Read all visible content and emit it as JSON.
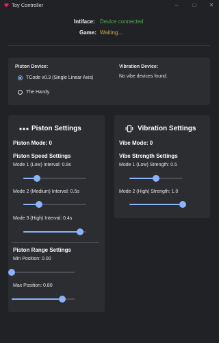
{
  "window": {
    "title": "Toy Controller",
    "minimize_icon": "minimize-icon",
    "maximize_icon": "maximize-icon",
    "close_icon": "close-icon"
  },
  "status": {
    "interface_label": "Intiface:",
    "interface_value": "Device connected",
    "interface_color": "#4caf50",
    "game_label": "Game:",
    "game_value": "Waiting...",
    "game_color": "#c7a94a"
  },
  "devices": {
    "piston_title": "Piston Device:",
    "piston_options": [
      {
        "label": "TCode v0.3 (Single Linear Axis)",
        "selected": true
      },
      {
        "label": "The Handy",
        "selected": false
      }
    ],
    "vibration_title": "Vibration Device:",
    "vibration_empty": "No vibe devices found."
  },
  "piston": {
    "title": "Piston Settings",
    "icon": "piston-dots-icon",
    "mode": "Piston Mode: 0",
    "speed_title": "Piston Speed Settings",
    "speed_sliders": [
      {
        "label": "Mode 1 (Low) Interval: 0.9s",
        "value": 0.22
      },
      {
        "label": "Mode 2 (Medium) Interval: 0.5s",
        "value": 0.25
      },
      {
        "label": "Mode 3 (High) Interval: 0.4s",
        "value": 0.9
      }
    ],
    "range_title": "Piston Range Settings",
    "range_sliders": [
      {
        "label": "Min Position: 0.00",
        "value": 0.0
      },
      {
        "label": "Max Position: 0.80",
        "value": 0.8
      }
    ]
  },
  "vibration": {
    "title": "Vibration Settings",
    "icon": "vibration-icon",
    "mode": "Vibe Mode: 0",
    "strength_title": "Vibe Strength Settings",
    "sliders": [
      {
        "label": "Mode 1 (Low) Strength: 0.5",
        "value": 0.5
      },
      {
        "label": "Mode 2 (High) Strength: 1.0",
        "value": 1.0
      }
    ]
  },
  "colors": {
    "accent": "#8ab4f8",
    "background": "#202225",
    "card": "#2b2d31"
  }
}
